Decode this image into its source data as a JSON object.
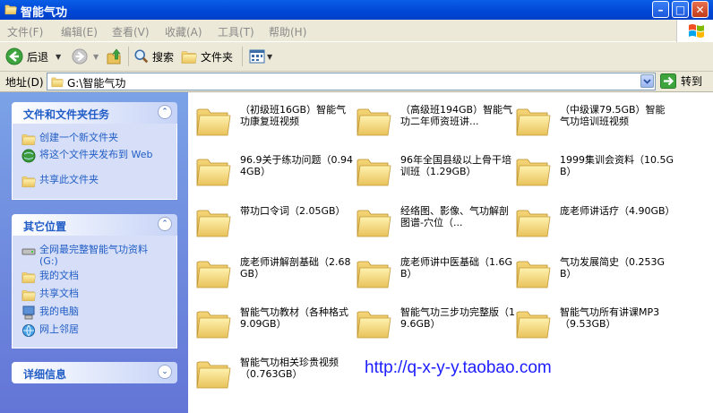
{
  "window": {
    "title": "智能气功"
  },
  "menu": [
    "文件(F)",
    "编辑(E)",
    "查看(V)",
    "收藏(A)",
    "工具(T)",
    "帮助(H)"
  ],
  "toolbar": {
    "back": "后退",
    "search": "搜索",
    "folders": "文件夹"
  },
  "address": {
    "label": "地址(D)",
    "path": "G:\\智能气功",
    "go": "转到"
  },
  "tasks": {
    "title": "文件和文件夹任务",
    "items": [
      "创建一个新文件夹",
      "将这个文件夹发布到 Web",
      "共享此文件夹"
    ]
  },
  "places": {
    "title": "其它位置",
    "items": [
      "全网最完整智能气功资料 (G:)",
      "我的文档",
      "共享文档",
      "我的电脑",
      "网上邻居"
    ]
  },
  "details": {
    "title": "详细信息"
  },
  "folders": [
    "（初级班16GB）智能气功康复班视频",
    "（高级班194GB）智能气功二年师资班讲...",
    "（中级课79.5GB）智能气功培训班视频",
    "96.9关于练功问题（0.944GB）",
    "96年全国县级以上骨干培训班（1.29GB）",
    "1999集训会资料（10.5GB）",
    "带功口令词（2.05GB）",
    "经络图、影像、气功解剖图谱-穴位（...",
    "庞老师讲话疗（4.90GB）",
    "庞老师讲解剖基础（2.68GB）",
    "庞老师讲中医基础（1.6GB）",
    "气功发展简史（0.253GB）",
    "智能气功教材（各种格式9.09GB）",
    "智能气功三步功完整版（19.6GB）",
    "智能气功所有讲课MP3（9.53GB）",
    "智能气功相关珍贵视频（0.763GB）"
  ],
  "watermark": "http://q-x-y-y.taobao.com"
}
